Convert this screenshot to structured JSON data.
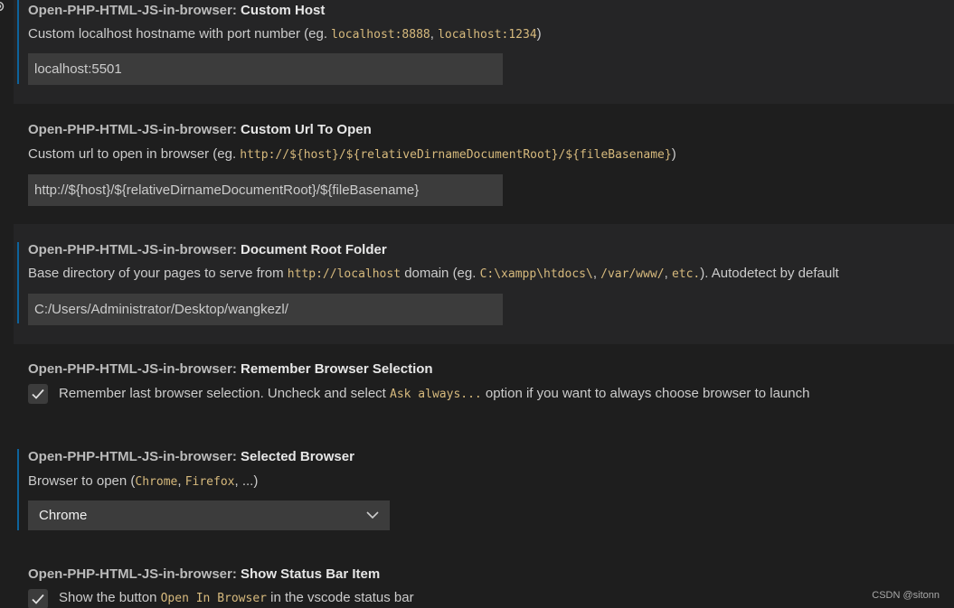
{
  "settings": [
    {
      "category": "Open-PHP-HTML-JS-in-browser:",
      "name": "Custom Host",
      "desc": [
        {
          "t": "Custom localhost hostname with port number (eg. "
        },
        {
          "c": "localhost:8888"
        },
        {
          "t": ", "
        },
        {
          "c": "localhost:1234"
        },
        {
          "t": ")"
        }
      ],
      "value": "localhost:5501"
    },
    {
      "category": "Open-PHP-HTML-JS-in-browser:",
      "name": "Custom Url To Open",
      "desc": [
        {
          "t": "Custom url to open in browser (eg. "
        },
        {
          "c": "http://${host}/${relativeDirnameDocumentRoot}/${fileBasename}"
        },
        {
          "t": ")"
        }
      ],
      "value": "http://${host}/${relativeDirnameDocumentRoot}/${fileBasename}"
    },
    {
      "category": "Open-PHP-HTML-JS-in-browser:",
      "name": "Document Root Folder",
      "desc": [
        {
          "t": "Base directory of your pages to serve from "
        },
        {
          "c": "http://localhost"
        },
        {
          "t": " domain (eg. "
        },
        {
          "c": "C:\\xampp\\htdocs\\"
        },
        {
          "t": ", "
        },
        {
          "c": "/var/www/"
        },
        {
          "t": ", "
        },
        {
          "c": "etc."
        },
        {
          "t": "). Autodetect by default"
        }
      ],
      "value": "C:/Users/Administrator/Desktop/wangkezl/"
    },
    {
      "category": "Open-PHP-HTML-JS-in-browser:",
      "name": "Remember Browser Selection",
      "checked": true,
      "desc": [
        {
          "t": "Remember last browser selection. Uncheck and select "
        },
        {
          "c": "Ask always..."
        },
        {
          "t": " option if you want to always choose browser to launch"
        }
      ]
    },
    {
      "category": "Open-PHP-HTML-JS-in-browser:",
      "name": "Selected Browser",
      "desc": [
        {
          "t": "Browser to open ("
        },
        {
          "c": "Chrome"
        },
        {
          "t": ", "
        },
        {
          "c": "Firefox"
        },
        {
          "t": ", ...)"
        }
      ],
      "value": "Chrome"
    },
    {
      "category": "Open-PHP-HTML-JS-in-browser:",
      "name": "Show Status Bar Item",
      "checked": true,
      "desc": [
        {
          "t": "Show the button "
        },
        {
          "c": "Open In Browser"
        },
        {
          "t": " in the vscode status bar"
        }
      ]
    }
  ],
  "icons": {
    "gear": "gear-icon",
    "chevron": "chevron-down-icon",
    "check": "check-icon"
  },
  "colors": {
    "accent": "#0e639c",
    "code": "#d7ba7d",
    "input_bg": "#3c3c3c"
  },
  "watermark": "CSDN @sitonn"
}
